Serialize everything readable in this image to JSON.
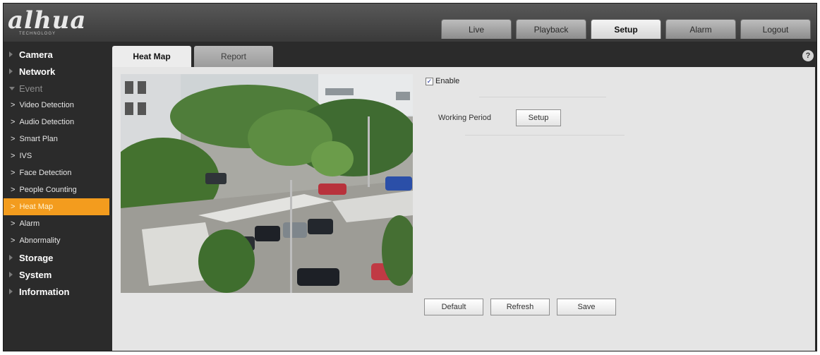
{
  "brand": {
    "logo": "alhua",
    "subtitle": "TECHNOLOGY"
  },
  "topnav": [
    "Live",
    "Playback",
    "Setup",
    "Alarm",
    "Logout"
  ],
  "topnav_active": "Setup",
  "sidebar": {
    "groups": [
      {
        "label": "Camera"
      },
      {
        "label": "Network"
      },
      {
        "label": "Event"
      },
      {
        "label": "Storage"
      },
      {
        "label": "System"
      },
      {
        "label": "Information"
      }
    ],
    "event_items": [
      "Video Detection",
      "Audio Detection",
      "Smart Plan",
      "IVS",
      "Face Detection",
      "People Counting",
      "Heat Map",
      "Alarm",
      "Abnormality"
    ],
    "active_item": "Heat Map"
  },
  "tabs": [
    "Heat Map",
    "Report"
  ],
  "help_icon": "?",
  "panel": {
    "enable_label": "Enable",
    "enable_checked": true,
    "working_period_label": "Working Period",
    "setup_button": "Setup",
    "buttons": {
      "default": "Default",
      "refresh": "Refresh",
      "save": "Save"
    }
  },
  "colors": {
    "accent": "#f39c1e",
    "sidebar_bg": "#2b2b2b",
    "panel_bg": "#e5e5e5"
  }
}
